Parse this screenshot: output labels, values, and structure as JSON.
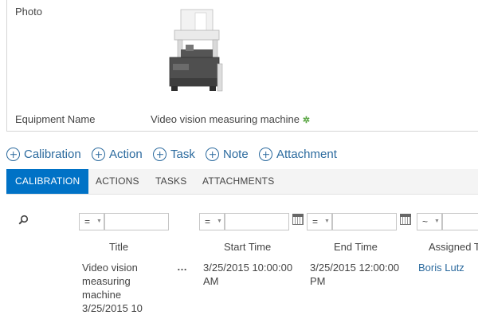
{
  "form": {
    "photo_label": "Photo",
    "equipment_label": "Equipment Name",
    "equipment_value": "Video vision measuring machine"
  },
  "actions": [
    {
      "label": "Calibration",
      "icon": "plus-circle-icon"
    },
    {
      "label": "Action",
      "icon": "plus-circle-icon"
    },
    {
      "label": "Task",
      "icon": "plus-circle-icon"
    },
    {
      "label": "Note",
      "icon": "plus-circle-icon"
    },
    {
      "label": "Attachment",
      "icon": "plus-circle-icon"
    }
  ],
  "tabs": [
    {
      "label": "CALIBRATION",
      "active": true
    },
    {
      "label": "ACTIONS",
      "active": false
    },
    {
      "label": "TASKS",
      "active": false
    },
    {
      "label": "ATTACHMENTS",
      "active": false
    }
  ],
  "filters": {
    "title_op": "=",
    "start_op": "=",
    "end_op": "=",
    "assigned_op": "~"
  },
  "columns": {
    "title": "Title",
    "start": "Start Time",
    "end": "End Time",
    "assigned": "Assigned T"
  },
  "rows": [
    {
      "title": "Video vision measuring machine 3/25/2015 10",
      "menu": "…",
      "start": "3/25/2015 10:00:00 AM",
      "end": "3/25/2015 12:00:00 PM",
      "assigned": "Boris Lutz"
    }
  ],
  "colors": {
    "accent": "#0072c6",
    "link": "#2b6a9e"
  }
}
